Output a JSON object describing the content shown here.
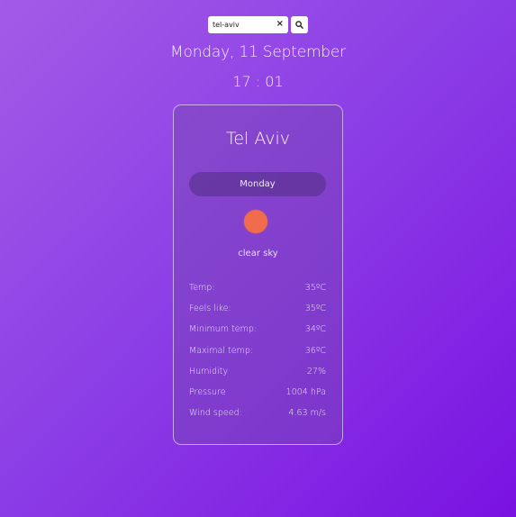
{
  "search": {
    "value": "tel-aviv",
    "placeholder": ""
  },
  "header": {
    "date": "Monday, 11 September",
    "time": "17 : 01"
  },
  "card": {
    "city": "Tel Aviv",
    "day": "Monday",
    "weather_icon": "sun-icon",
    "description": "clear sky",
    "details": [
      {
        "label": "Temp:",
        "value": "35ºC"
      },
      {
        "label": "Feels like:",
        "value": "35ºC"
      },
      {
        "label": "Minimum temp:",
        "value": "34ºC"
      },
      {
        "label": "Maximal temp:",
        "value": "36ºC"
      },
      {
        "label": "Humidity",
        "value": "27%"
      },
      {
        "label": "Pressure",
        "value": "1004 hPa"
      },
      {
        "label": "Wind speed:",
        "value": "4.63 m/s"
      }
    ]
  },
  "colors": {
    "background_start": "#a35be6",
    "background_end": "#7a12e2",
    "sun": "#f06c4c"
  }
}
